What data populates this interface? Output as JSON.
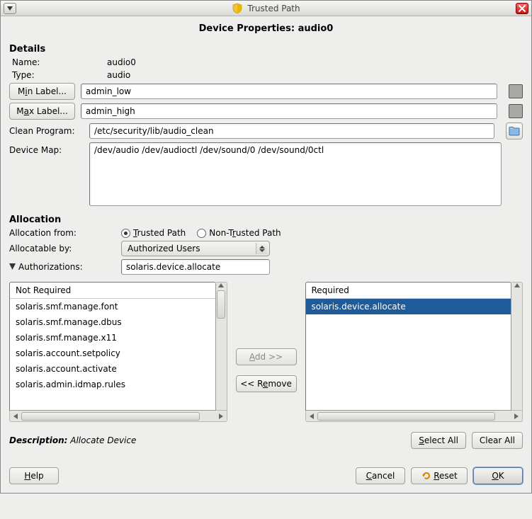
{
  "titlebar": {
    "title": "Trusted Path"
  },
  "subtitle": "Device Properties: audio0",
  "details": {
    "header": "Details",
    "name_label": "Name:",
    "name_value": "audio0",
    "type_label": "Type:",
    "type_value": "audio",
    "min_label_btn": "Min Label...",
    "min_label_value": "admin_low",
    "max_label_btn": "Max Label...",
    "max_label_value": "admin_high",
    "clean_program_label": "Clean Program:",
    "clean_program_value": "/etc/security/lib/audio_clean",
    "device_map_label": "Device Map:",
    "device_map_value": "/dev/audio /dev/audioctl /dev/sound/0 /dev/sound/0ctl"
  },
  "allocation": {
    "header": "Allocation",
    "from_label": "Allocation from:",
    "radio_trusted": "Trusted Path",
    "radio_nontrusted": "Non-Trusted Path",
    "trusted_selected": true,
    "allocatable_by_label": "Allocatable by:",
    "allocatable_by_value": "Authorized Users",
    "authorizations_label": "Authorizations:",
    "authorizations_value": "solaris.device.allocate",
    "not_required_header": "Not Required",
    "not_required": [
      "solaris.smf.manage.font",
      "solaris.smf.manage.dbus",
      "solaris.smf.manage.x11",
      "solaris.account.setpolicy",
      "solaris.account.activate",
      "solaris.admin.idmap.rules"
    ],
    "required_header": "Required",
    "required": [
      "solaris.device.allocate"
    ],
    "add_btn": "Add >>",
    "remove_btn": "<< Remove",
    "description_label": "Description:",
    "description_value": "Allocate Device",
    "select_all_btn": "Select All",
    "clear_all_btn": "Clear All"
  },
  "bottom": {
    "help_btn": "Help",
    "cancel_btn": "Cancel",
    "reset_btn": "Reset",
    "ok_btn": "OK"
  }
}
